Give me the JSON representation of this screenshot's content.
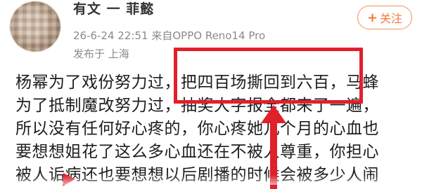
{
  "post": {
    "username_visible": "有文 一 菲懿",
    "follow_label": "关注",
    "follow_prefix": "+",
    "date": "26-6-24 22:51",
    "source_prefix": "来自",
    "device": "OPPO Reno14 Pro",
    "location": "发布于 上海",
    "lines": [
      "杨幂为了戏份努力过，把四百场撕回到六百，马蜂",
      "为了抵制魔改努力过，抽奖大字报全都来了一遍，",
      "所以没有任何好心疼的，你心疼她几个月的心血也",
      "要想想姐花了这么多心血还在不被人尊重，你担心",
      "被人诟病还也要想想以后剧播的时候会被多少人闹"
    ]
  },
  "colors": {
    "highlight": "#e1202a",
    "follow": "#f07a36",
    "meta": "#8a8a8a"
  },
  "icons": {
    "follow": "plus-icon",
    "arrow": "up-arrow-annotation"
  }
}
